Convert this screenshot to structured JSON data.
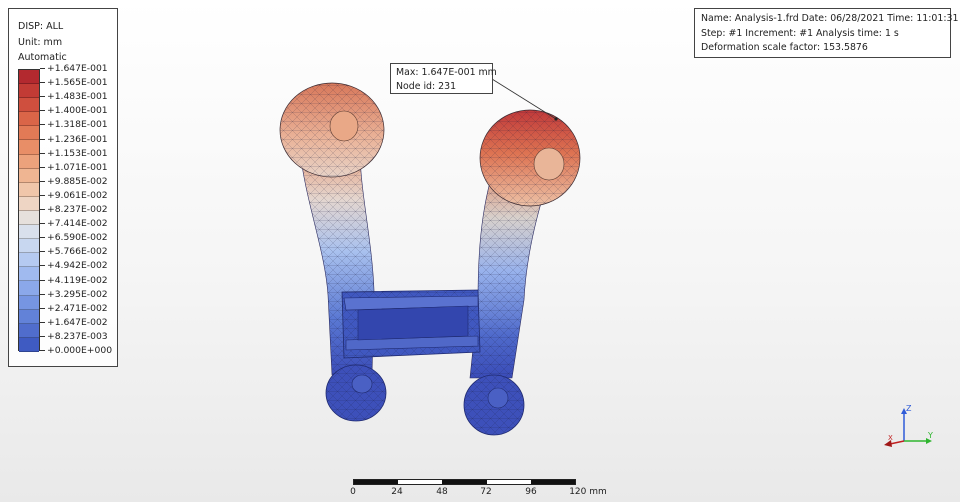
{
  "legend": {
    "title": "DISP: ALL",
    "unit": "Unit: mm",
    "mode": "Automatic",
    "entries": [
      {
        "label": "+1.647E-001",
        "color": "#b3292f"
      },
      {
        "label": "+1.565E-001",
        "color": "#c23b35"
      },
      {
        "label": "+1.483E-001",
        "color": "#cf4f3e"
      },
      {
        "label": "+1.400E-001",
        "color": "#da6548"
      },
      {
        "label": "+1.318E-001",
        "color": "#e27a56"
      },
      {
        "label": "+1.236E-001",
        "color": "#e88e67"
      },
      {
        "label": "+1.153E-001",
        "color": "#eca27c"
      },
      {
        "label": "+1.071E-001",
        "color": "#efb592"
      },
      {
        "label": "+9.885E-002",
        "color": "#f0c6aa"
      },
      {
        "label": "+9.061E-002",
        "color": "#eed5c4"
      },
      {
        "label": "+8.237E-002",
        "color": "#e6e0dc"
      },
      {
        "label": "+7.414E-002",
        "color": "#d9e0ec"
      },
      {
        "label": "+6.590E-002",
        "color": "#c8d7f0"
      },
      {
        "label": "+5.766E-002",
        "color": "#b5caf1"
      },
      {
        "label": "+4.942E-002",
        "color": "#a0baef"
      },
      {
        "label": "+4.119E-002",
        "color": "#8ba8ea"
      },
      {
        "label": "+3.295E-002",
        "color": "#7695e2"
      },
      {
        "label": "+2.471E-002",
        "color": "#6282d8"
      },
      {
        "label": "+1.647E-002",
        "color": "#506dcc"
      },
      {
        "label": "+8.237E-003",
        "color": "#3f5bc2"
      },
      {
        "label": "+0.000E+000",
        "color": "#3a4cb8"
      }
    ]
  },
  "info": {
    "line1": "Name: Analysis-1.frd   Date: 06/28/2021   Time: 11:01:31",
    "line2": "Step: #1   Increment: #1   Analysis time: 1 s",
    "line3": "Deformation scale factor: 153.5876"
  },
  "callout": {
    "max": "Max: 1.647E-001 mm",
    "node": "Node id: 231"
  },
  "scale": {
    "labels": [
      "0",
      "24",
      "48",
      "72",
      "96",
      "120 mm"
    ]
  },
  "triad": {
    "z": "Z",
    "y": "Y",
    "x": "X"
  },
  "colors": {
    "low": "#3a4cb8",
    "high": "#b3292f"
  }
}
